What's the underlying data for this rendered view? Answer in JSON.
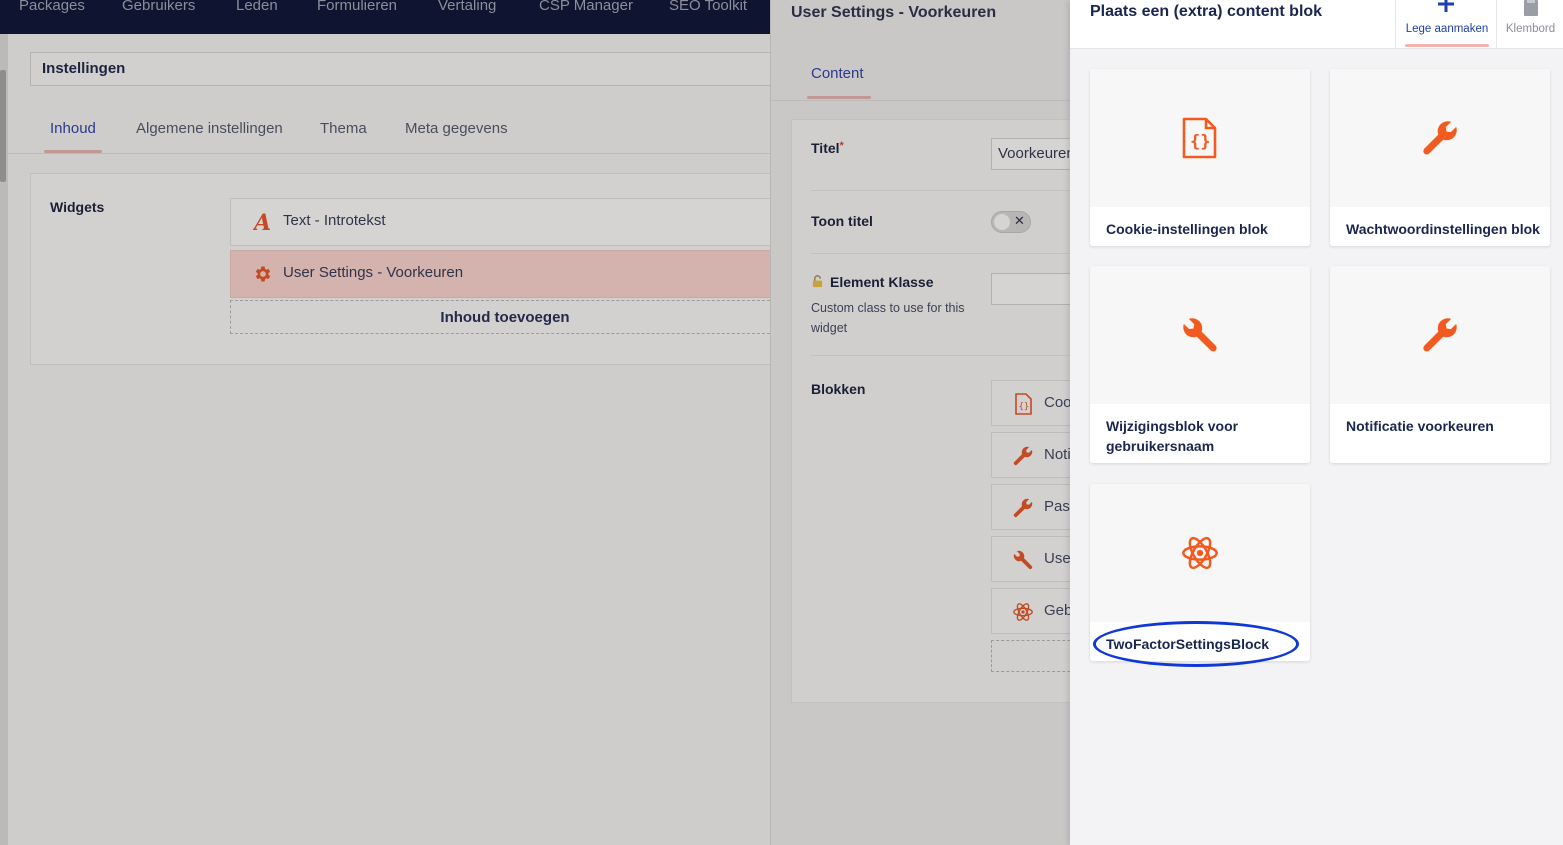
{
  "topnav": {
    "items": [
      "Packages",
      "Gebruikers",
      "Leden",
      "Formulieren",
      "Vertaling",
      "CSP Manager",
      "SEO Toolkit"
    ]
  },
  "document": {
    "name_value": "Instellingen",
    "tabs": [
      "Inhoud",
      "Algemene instellingen",
      "Thema",
      "Meta gegevens"
    ],
    "active_tab": "Inhoud",
    "widgets_label": "Widgets",
    "widgets": [
      {
        "label": "Text - Introtekst",
        "icon": "text-a-icon"
      },
      {
        "label": "User Settings - Voorkeuren",
        "icon": "gear-icon"
      }
    ],
    "add_content_label": "Inhoud toevoegen"
  },
  "editor": {
    "title": "User Settings - Voorkeuren",
    "tab": "Content",
    "titel_label": "Titel",
    "required_mark": "*",
    "titel_value": "Voorkeuren",
    "toon_titel_label": "Toon titel",
    "toggle_off_glyph": "✕",
    "element_klasse_label": "Element Klasse",
    "element_klasse_desc": "Custom class to use for this widget",
    "blokken_label": "Blokken",
    "blocks": [
      {
        "label": "Coo",
        "icon": "code-file-icon"
      },
      {
        "label": "Noti",
        "icon": "wrench-icon"
      },
      {
        "label": "Pass",
        "icon": "wrench-icon"
      },
      {
        "label": "User",
        "icon": "wrench-icon"
      },
      {
        "label": "Geb",
        "icon": "atom-icon"
      }
    ]
  },
  "drawer": {
    "title": "Plaats een (extra) content blok",
    "create_empty_label": "Lege aanmaken",
    "clipboard_label": "Klembord",
    "tiles": [
      {
        "label": "Cookie-instellingen blok",
        "icon": "code-file-icon"
      },
      {
        "label": "Wachtwoordinstellingen blok",
        "icon": "wrench-icon"
      },
      {
        "label": "Wijzigingsblok voor gebruikersnaam",
        "icon": "wrench-icon"
      },
      {
        "label": "Notificatie voorkeuren",
        "icon": "wrench-icon"
      },
      {
        "label": "TwoFactorSettingsBlock",
        "icon": "atom-icon"
      }
    ]
  },
  "colors": {
    "accent": "#f35a1f",
    "brand_blue": "#1e3fae",
    "nav_bg": "#0f1530",
    "highlight": "#1038d6"
  }
}
